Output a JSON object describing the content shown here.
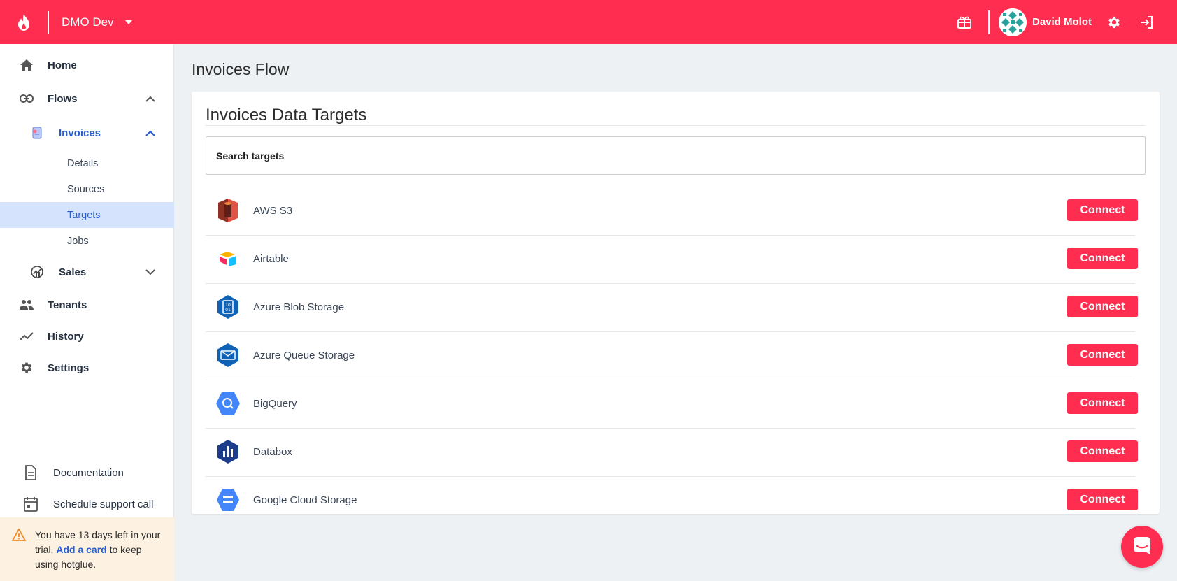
{
  "topbar": {
    "workspace": "DMO Dev",
    "username": "David Molot",
    "accent": "#ff2d50"
  },
  "sidebar": {
    "home": "Home",
    "flows": "Flows",
    "invoices": "Invoices",
    "invoices_sub": [
      "Details",
      "Sources",
      "Targets",
      "Jobs"
    ],
    "active_sub": "Targets",
    "sales": "Sales",
    "tenants": "Tenants",
    "history": "History",
    "settings": "Settings",
    "documentation": "Documentation",
    "support": "Schedule support call",
    "trial": {
      "prefix": "You have 13 days left in your trial.",
      "link": "Add a card",
      "suffix": "to keep using hotglue."
    }
  },
  "main": {
    "page_title": "Invoices Flow",
    "card_title": "Invoices Data Targets",
    "search_placeholder": "Search targets",
    "targets": [
      {
        "name": "AWS S3",
        "icon": "aws-s3-icon",
        "button": "Connect"
      },
      {
        "name": "Airtable",
        "icon": "airtable-icon",
        "button": "Connect"
      },
      {
        "name": "Azure Blob Storage",
        "icon": "azure-blob-icon",
        "button": "Connect"
      },
      {
        "name": "Azure Queue Storage",
        "icon": "azure-queue-icon",
        "button": "Connect"
      },
      {
        "name": "BigQuery",
        "icon": "bigquery-icon",
        "button": "Connect"
      },
      {
        "name": "Databox",
        "icon": "databox-icon",
        "button": "Connect"
      },
      {
        "name": "Google Cloud Storage",
        "icon": "gcs-icon",
        "button": "Connect"
      }
    ]
  }
}
